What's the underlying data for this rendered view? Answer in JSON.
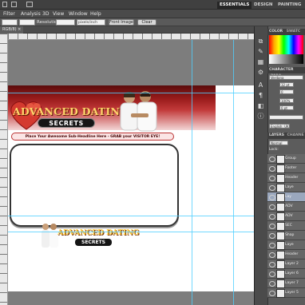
{
  "workspaces": [
    "ESSENTIALS",
    "DESIGN",
    "PAINTING"
  ],
  "menu": [
    "Filter",
    "Analysis",
    "3D",
    "View",
    "Window",
    "Help"
  ],
  "options": {
    "resolution_label": "Resolution:",
    "unit": "pixels/inch",
    "front_image_label": "Front Image",
    "clear_label": "Clear"
  },
  "document": {
    "tab": "RGB/8) ×"
  },
  "banner": {
    "title": "ADVANCED DATING",
    "subtitle": "SECRETS",
    "subheadline": "Place Your Awesome Sub-Headline Here - GRAB your VISITOR EYE!"
  },
  "footer": {
    "title": "ADVANCED DATING",
    "subtitle": "SECRETS"
  },
  "panels": {
    "color_tab": "COLOR",
    "swatches_tab": "SWATC",
    "character_tab": "CHARACTER",
    "paragraph_tab": "PARA",
    "font": "Verdana",
    "size": "32 pt",
    "leading": "0",
    "scale": "100%",
    "tracking": "0 pt",
    "language": "English: UK",
    "layers_tab": "LAYERS",
    "channels_tab": "CHANNE",
    "blend_mode": "Normal",
    "lock_label": "Lock:"
  },
  "layers": [
    "Group",
    "Footer",
    "Header",
    "Laye",
    "Lay",
    "ADV",
    "ADV",
    "SEC",
    "Shap",
    "Laye",
    "Header",
    "Layer 2",
    "Layer 6",
    "Layer 7",
    "Layer 5"
  ]
}
